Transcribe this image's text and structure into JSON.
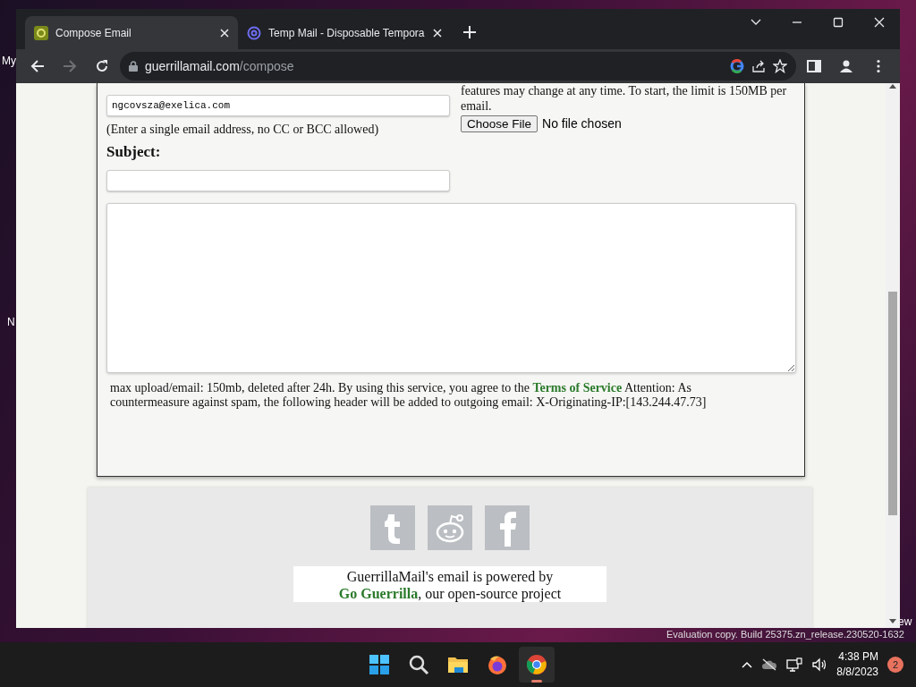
{
  "desktop": {
    "labels": [
      "My",
      "N",
      "ew"
    ],
    "build_text": "Evaluation copy. Build 25375.zn_release.230520-1632"
  },
  "browser": {
    "tabs": [
      {
        "title": "Compose Email",
        "kind": "guerrilla",
        "selected": true
      },
      {
        "title": "Temp Mail - Disposable Tempora",
        "kind": "at",
        "selected": false
      }
    ],
    "address": {
      "host": "guerrillamail.com",
      "path": "/compose"
    }
  },
  "page": {
    "email_value": "ngcovsza@exelica.com",
    "email_hint": "(Enter a single email address, no CC or BCC allowed)",
    "subject_label": "Subject:",
    "attach_text": "features may change at any time. To start, the limit is 150MB per email.",
    "file_button": "Choose File",
    "file_status": "No file chosen",
    "notice_before": "max upload/email: 150mb, deleted after 24h. By using this service, you agree to the",
    "terms_link": "Terms of Service",
    "notice_after": "Attention: As countermeasure against spam, the following header will be added to outgoing email: X-Originating-IP:[143.244.47.73]"
  },
  "footer": {
    "social": [
      {
        "kind": "tumblr"
      },
      {
        "kind": "reddit"
      },
      {
        "kind": "facebook"
      }
    ],
    "powered_text": "GuerrillaMail's email is powered by",
    "powered_link": "Go Guerrilla",
    "powered_after": ", our open-source project"
  },
  "taskbar": {
    "apps": [
      {
        "kind": "start",
        "active": false
      },
      {
        "kind": "search",
        "active": false
      },
      {
        "kind": "folder",
        "active": false
      },
      {
        "kind": "firefox",
        "active": false
      },
      {
        "kind": "chrome",
        "active": true
      }
    ],
    "time": "4:38 PM",
    "date": "8/8/2023",
    "badge": "2"
  }
}
